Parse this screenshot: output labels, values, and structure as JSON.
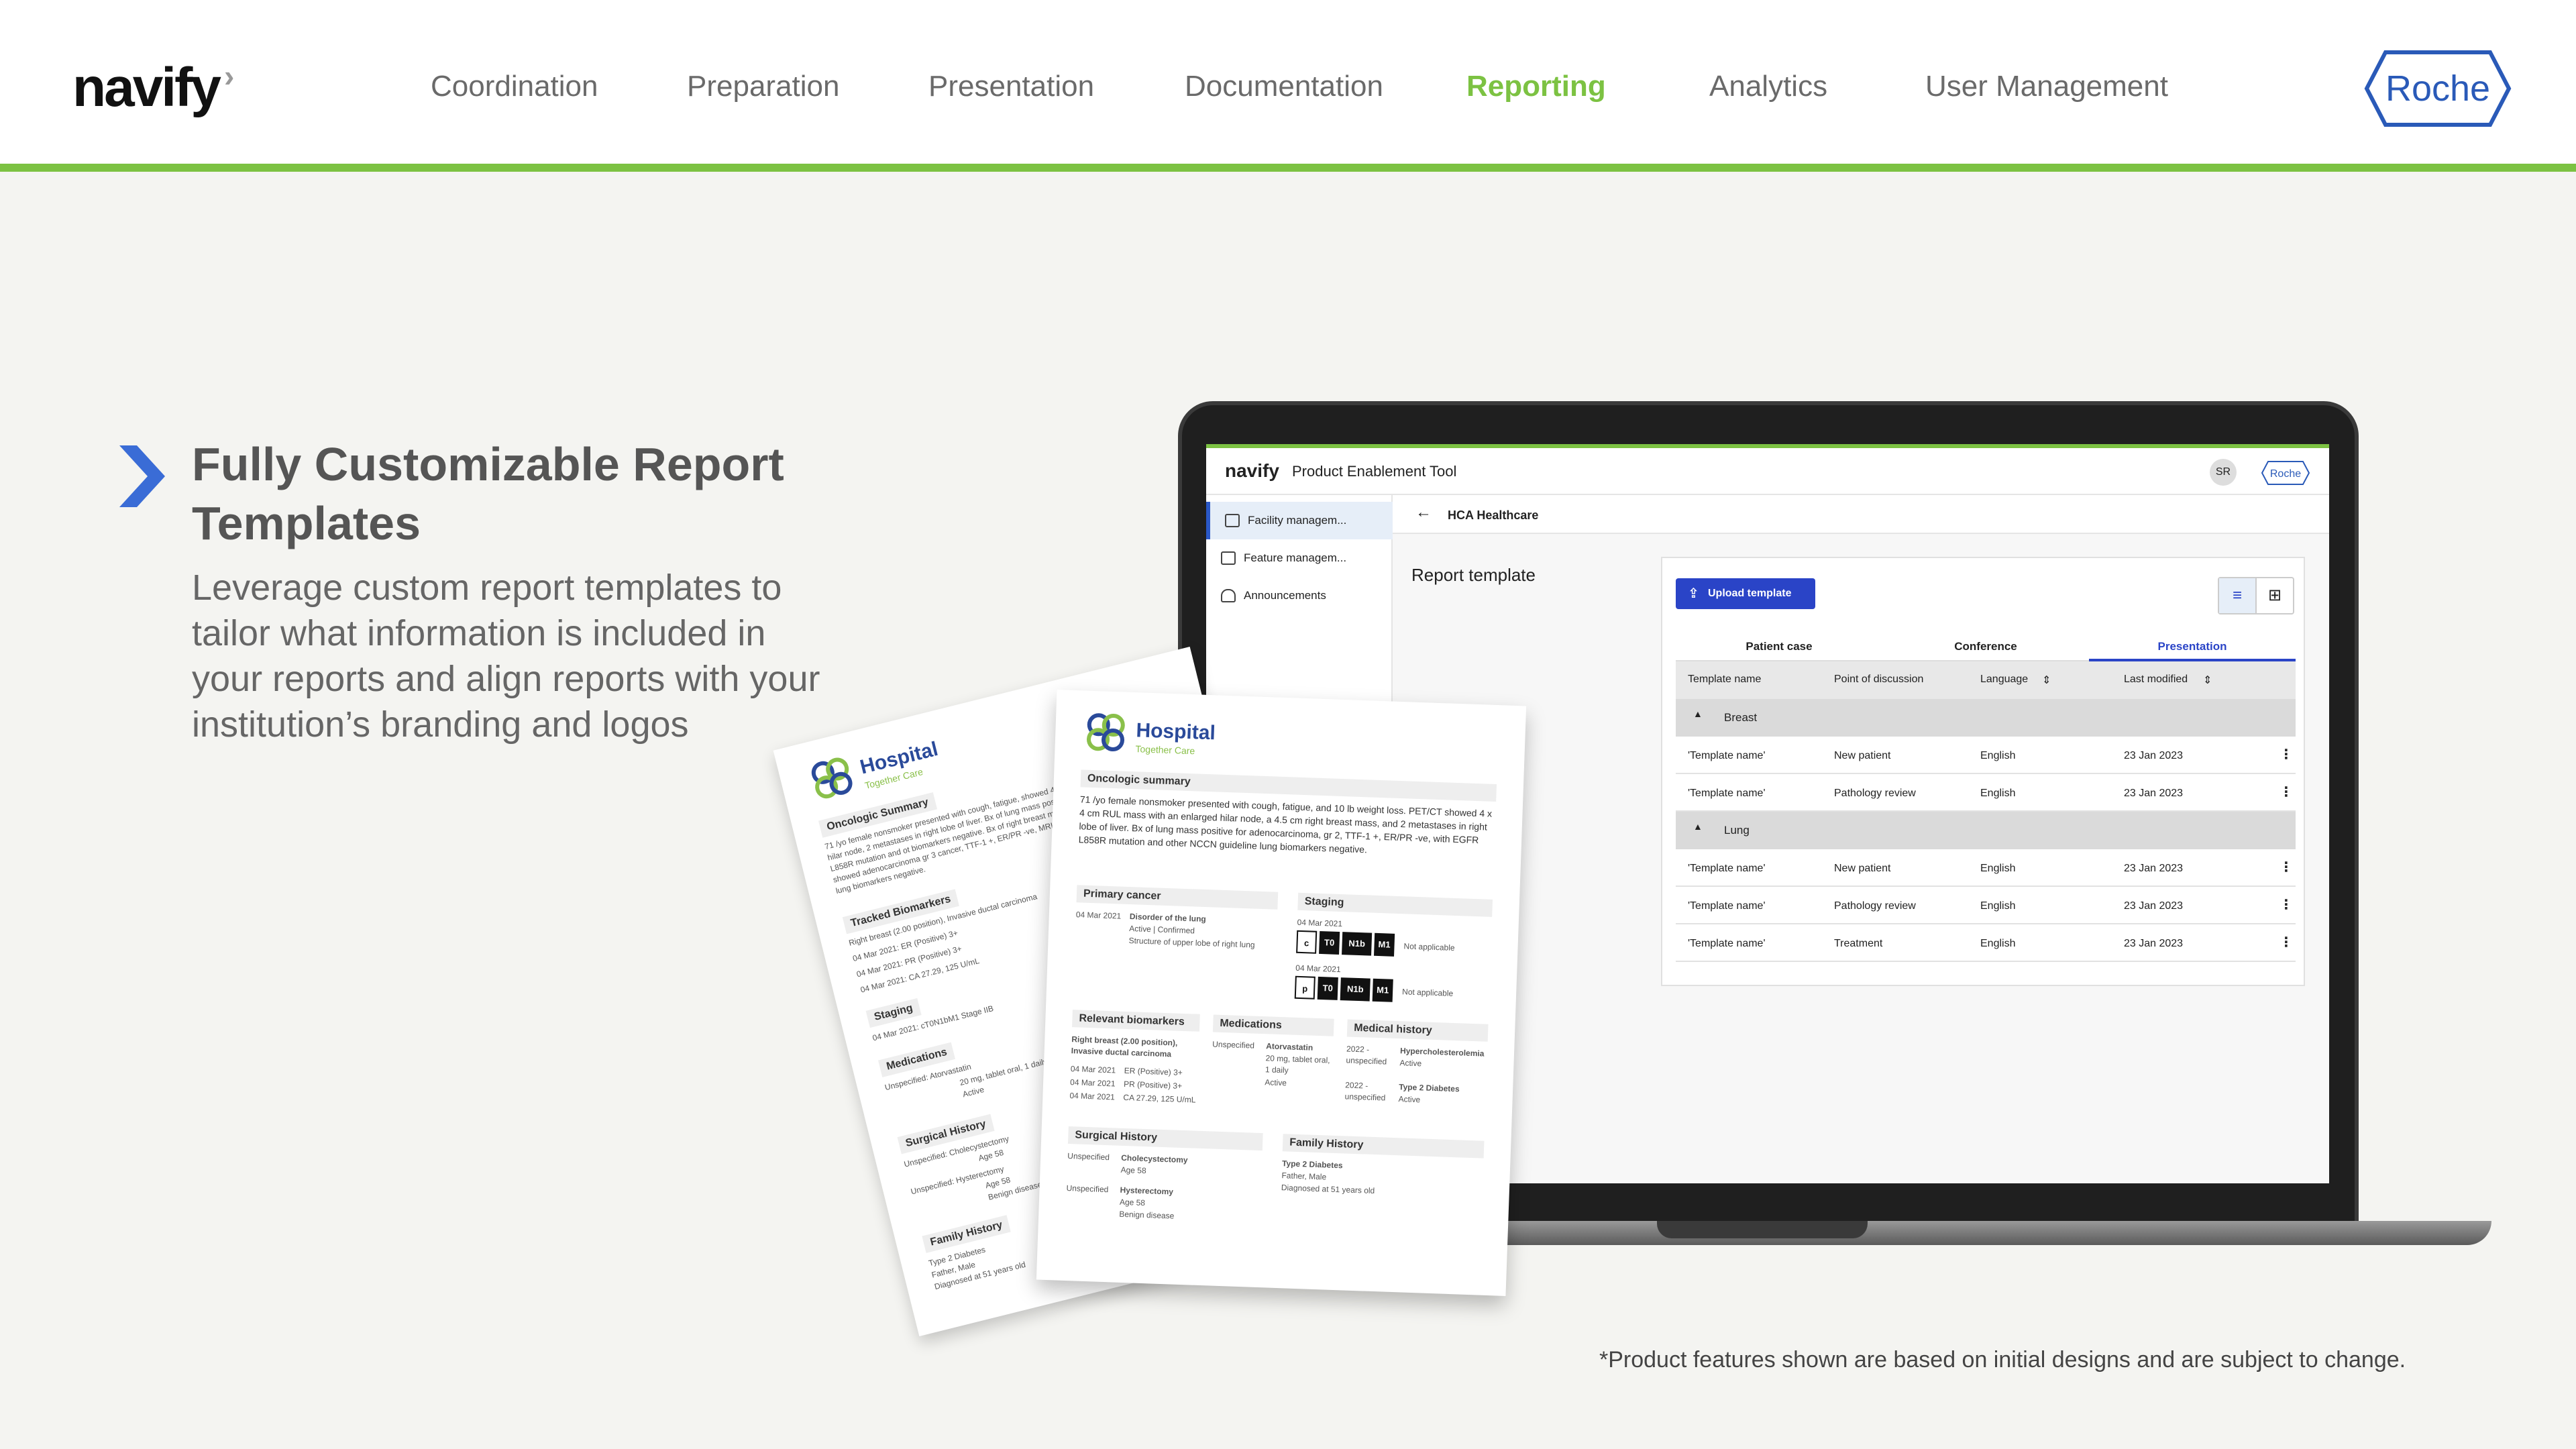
{
  "nav": {
    "brand": "navify",
    "items": [
      "Coordination",
      "Preparation",
      "Presentation",
      "Documentation",
      "Reporting",
      "Analytics",
      "User Management"
    ],
    "active": "Reporting",
    "partner_logo": "Roche"
  },
  "feature": {
    "title": "Fully Customizable Report Templates",
    "description": "Leverage custom report templates to tailor what information is included in your reports and align reports with your institution’s branding and logos"
  },
  "footnote": "*Product features shown are based on initial designs and are subject to change.",
  "colors": {
    "accent_green": "#7cc242",
    "primary_blue": "#2a44c7"
  },
  "app": {
    "brand": "navify",
    "title": "Product Enablement Tool",
    "avatar": "SR",
    "logo": "Roche",
    "sidebar": [
      {
        "label": "Facility managem...",
        "icon": "building-icon"
      },
      {
        "label": "Feature managem...",
        "icon": "list-icon"
      },
      {
        "label": "Announcements",
        "icon": "bell-icon"
      }
    ],
    "breadcrumb": "HCA Healthcare",
    "section_title": "Report template",
    "upload_label": "Upload template",
    "tabs": [
      "Patient case",
      "Conference",
      "Presentation"
    ],
    "active_tab": "Presentation",
    "columns": [
      "Template name",
      "Point of discussion",
      "Language",
      "Last modified"
    ],
    "groups": [
      {
        "name": "Breast",
        "rows": [
          {
            "name": "'Template name'",
            "point": "New patient",
            "language": "English",
            "modified": "23 Jan 2023"
          },
          {
            "name": "'Template name'",
            "point": "Pathology review",
            "language": "English",
            "modified": "23 Jan 2023"
          }
        ]
      },
      {
        "name": "Lung",
        "rows": [
          {
            "name": "'Template name'",
            "point": "New patient",
            "language": "English",
            "modified": "23 Jan 2023"
          },
          {
            "name": "'Template name'",
            "point": "Pathology review",
            "language": "English",
            "modified": "23 Jan 2023"
          },
          {
            "name": "'Template name'",
            "point": "Treatment",
            "language": "English",
            "modified": "23 Jan 2023"
          }
        ]
      }
    ]
  },
  "report_front": {
    "hospital": "Hospital",
    "tagline": "Together Care",
    "summary_title": "Oncologic summary",
    "summary": "71 /yo female nonsmoker presented with cough, fatigue, and 10 lb weight loss. PET/CT showed 4 x 4 cm RUL mass with an enlarged hilar node, a 4.5 cm right breast mass, and 2 metastases in right lobe of liver. Bx of lung mass positive for adenocarcinoma, gr 2, TTF-1 +, ER/PR -ve, with EGFR L858R mutation and other NCCN guideline lung biomarkers negative.",
    "primary_title": "Primary cancer",
    "primary_date": "04 Mar 2021",
    "primary_disorder": "Disorder of the lung",
    "primary_status": "Active | Confirmed",
    "primary_structure": "Structure of upper lobe of right lung",
    "staging_title": "Staging",
    "staging_date1": "04 Mar 2021",
    "staging_date2": "04 Mar 2021",
    "stage_c": "c",
    "stage_p": "p",
    "stage_t": "T0",
    "stage_n": "N1b",
    "stage_m": "M1",
    "not_applicable": "Not applicable",
    "biomarkers_title": "Relevant biomarkers",
    "biomarker_desc": "Right breast (2.00 position), Invasive ductal carcinoma",
    "biomarkers": [
      "ER (Positive) 3+",
      "PR (Positive) 3+",
      "CA 27.29, 125 U/mL"
    ],
    "biomarker_date": "04 Mar 2021",
    "medications_title": "Medications",
    "med_unspecified": "Unspecified",
    "med_name": "Atorvastatin",
    "med_dose": "20 mg, tablet oral, 1 daily",
    "med_status": "Active",
    "history_title": "Medical history",
    "history_year": "2022 - unspecified",
    "history_items": [
      "Hypercholesterolemia",
      "Type 2 Diabetes"
    ],
    "history_status": "Active",
    "surgical_title": "Surgical History",
    "surgical_items": [
      "Cholecystectomy",
      "Hysterectomy"
    ],
    "surgical_age": "Age 58",
    "surgical_note": "Benign disease",
    "family_title": "Family History",
    "family_item": "Type 2 Diabetes",
    "family_who": "Father, Male",
    "family_dx": "Diagnosed at 51 years old"
  },
  "report_back": {
    "hospital": "Hospital",
    "tagline": "Together Care",
    "summary_title": "Oncologic Summary",
    "summary": "71 /yo female nonsmoker presented with cough, fatigue, showed 4 x 4 cm RUL mass with an enlarged hilar node, 2 metastases in right lobe of liver. Bx of lung mass posit TTF-1 +, ER/PR -ve, with EGFR L858R mutation and ot biomarkers negative. Bx of right breast mass showed IDC of liver metastases showed adenocarcinoma gr 3 cancer, TTF-1 +, ER/PR -ve, MRI brain normal. and other NCCN guideline lung biomarkers negative.",
    "tracked_title": "Tracked Biomarkers",
    "tracked_desc": "Right breast (2.00 position), Invasive ductal carcinoma",
    "tracked": [
      "04 Mar 2021: ER (Positive) 3+",
      "04 Mar 2021: PR (Positive) 3+",
      "04 Mar 2021: CA 27.29, 125 U/mL"
    ],
    "staging_title": "Staging",
    "staging_line": "04 Mar 2021: cT0N1bM1 Stage IIB",
    "medications_title": "Medications",
    "med_line": "Unspecified: Atorvastatin",
    "med_dose": "20 mg, tablet oral, 1 daily",
    "med_status": "Active",
    "surgical_title": "Surgical History",
    "surgical_line1": "Unspecified: Cholecystectomy",
    "surgical_line2": "Unspecified: Hysterectomy",
    "surgical_age": "Age 58",
    "surgical_note": "Benign disease",
    "family_title": "Family History",
    "family_item": "Type 2 Diabetes",
    "family_who": "Father, Male",
    "family_dx": "Diagnosed at 51 years old"
  }
}
